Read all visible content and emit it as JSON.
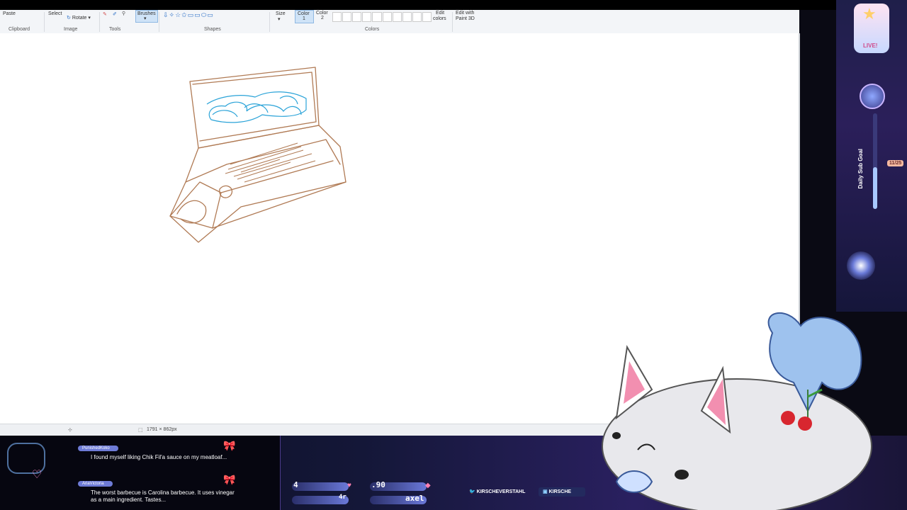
{
  "ribbon": {
    "clipboard": {
      "paste": "Paste",
      "label": "Clipboard"
    },
    "image": {
      "select": "Select",
      "rotate": "Rotate ▾",
      "label": "Image"
    },
    "tools": {
      "label": "Tools"
    },
    "brushes": {
      "label": "Brushes"
    },
    "shapes": {
      "label": "Shapes"
    },
    "size": {
      "label": "Size"
    },
    "color1": {
      "label": "Color",
      "num": "1"
    },
    "color2": {
      "label": "Color",
      "num": "2"
    },
    "colors": {
      "label": "Colors"
    },
    "edit_colors": {
      "line1": "Edit",
      "line2": "colors"
    },
    "paint3d": {
      "line1": "Edit with",
      "line2": "Paint 3D"
    }
  },
  "status": {
    "dimensions": "1791 × 862px"
  },
  "chat": [
    {
      "user": "PunishedKoko",
      "text": "I found myself liking Chik Fil'a sauce on my meatloaf..."
    },
    {
      "user": "AriaVictoria",
      "text": "The worst barbecue is Carolina barbecue. It uses vinegar as a main ingredient. Tastes..."
    }
  ],
  "stats": {
    "left_value": "4",
    "mid_value": ".90",
    "bottom_left": "4r",
    "bottom_mid": "axel"
  },
  "social": {
    "twitter": "KIRSCHEVERSTAHL",
    "discord": "KIRSCHE"
  },
  "sidebar": {
    "live": "LIVE!",
    "goal_label": "Daily Sub Goal",
    "goal_count": "11/25",
    "goal_fraction": 0.44
  },
  "colors": {
    "accent": "#6e7bd6",
    "drawing_brown": "#b07a54",
    "drawing_blue": "#2aa3d8"
  }
}
